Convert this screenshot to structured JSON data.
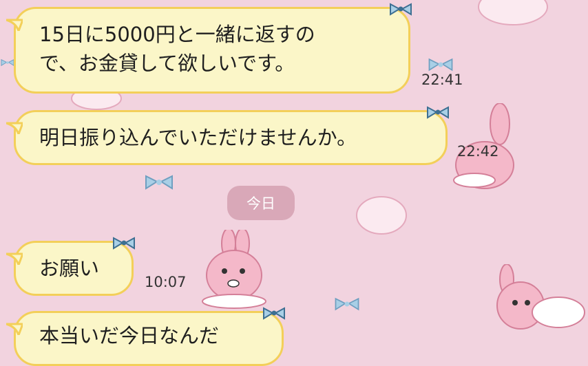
{
  "messages": [
    {
      "lines": [
        "15日に5000円と一緒に返すの",
        "で、お金貸して欲しいです。"
      ],
      "time": "22:41"
    },
    {
      "lines": [
        "明日振り込んでいただけませんか。"
      ],
      "time": "22:42"
    },
    {
      "lines": [
        "お願い"
      ],
      "time": "10:07"
    },
    {
      "lines": [
        "本当いだ今日なんだ"
      ],
      "time": ""
    }
  ],
  "date_separator": "今日",
  "colors": {
    "background": "#f2d3df",
    "bubble_fill": "#fbf6c8",
    "bubble_border": "#f3cf59",
    "pill": "#d9a8b8",
    "bow": "#a9cfe6"
  },
  "icons": [
    "bow-icon",
    "bunny-sticker-icon",
    "cloud-deco-icon"
  ]
}
